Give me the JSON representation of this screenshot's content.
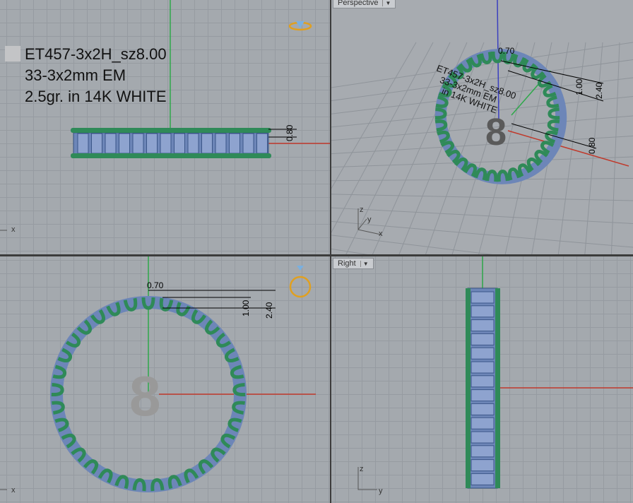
{
  "viewports": {
    "top_left": {
      "axis": "x"
    },
    "perspective": {
      "label": "Perspective",
      "axes": [
        "z",
        "y",
        "x"
      ],
      "dims": [
        "0.70",
        "1.00",
        "2.40",
        "0.80"
      ],
      "digit": "8",
      "note": [
        "ET457-3x2H_sz8.00",
        "33-3x2mm EM",
        "in 14K WHITE"
      ]
    },
    "bottom_left": {
      "axis": "x",
      "dims": [
        "0.70",
        "1.00",
        "2.40"
      ],
      "digit": "8"
    },
    "right": {
      "label": "Right",
      "axes": [
        "z",
        "y"
      ]
    }
  },
  "annotation": {
    "line1": "ET457-3x2H_sz8.00",
    "line2": "33-3x2mm EM",
    "line3": "2.5gr.  in 14K WHITE"
  },
  "front_dim": "0.80",
  "colors": {
    "metal": "#2f8a58",
    "gem": "#6d86b8",
    "xaxis": "#c0392b",
    "yaxis": "#2ea84a",
    "zaxis": "#3a3fbf"
  }
}
